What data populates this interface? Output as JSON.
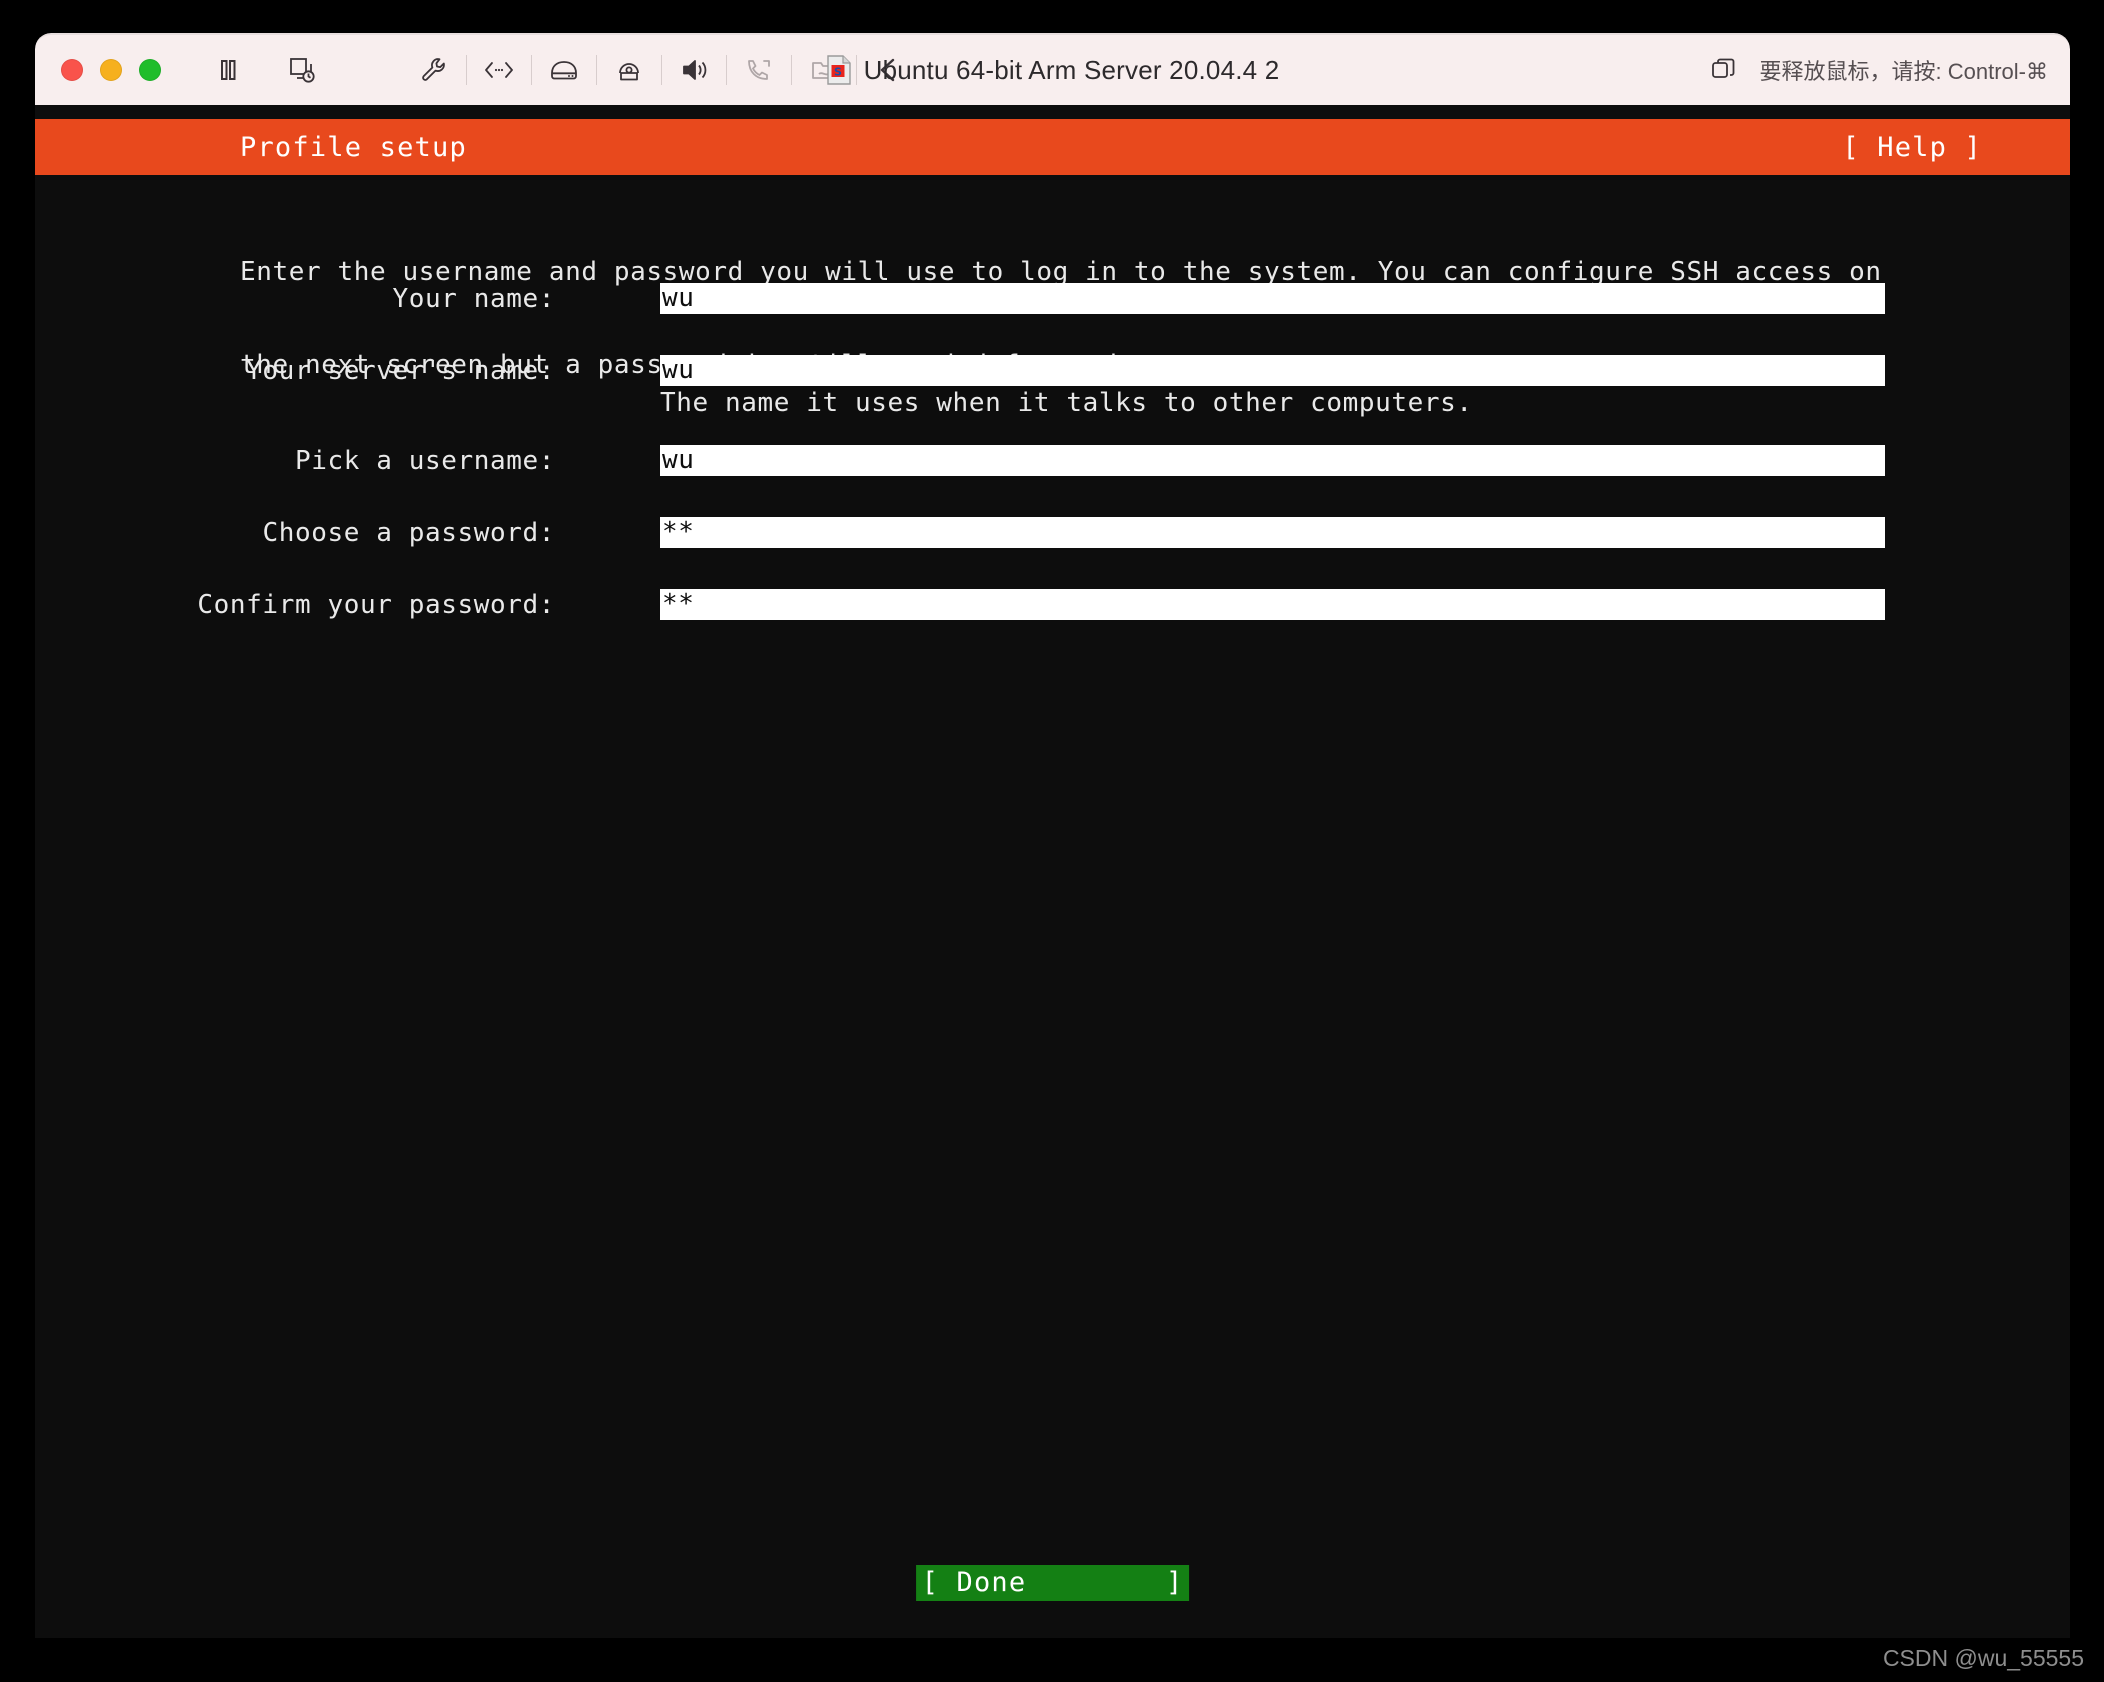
{
  "window": {
    "title": "Ubuntu 64-bit Arm Server 20.04.4 2",
    "release_hint": "要释放鼠标，请按: Control-⌘",
    "traffic_lights": [
      {
        "name": "close",
        "color": "#f9534b"
      },
      {
        "name": "minimize",
        "color": "#f6b01e"
      },
      {
        "name": "zoom",
        "color": "#1fbd2b"
      }
    ],
    "toolbar_icons": [
      "pause-icon",
      "snapshot-icon",
      "settings-wrench-icon",
      "network-icon",
      "hard-disk-icon",
      "camera-icon",
      "sound-icon",
      "usb-phone-icon",
      "shared-folder-icon",
      "back-chevron-icon",
      "window-mode-icon"
    ]
  },
  "installer": {
    "header_title": "Profile setup",
    "help_label": "[ Help ]",
    "accent_color": "#e8491d",
    "intro_lines": [
      "Enter the username and password you will use to log in to the system. You can configure SSH access on",
      "the next screen but a password is still needed for sudo."
    ],
    "fields": [
      {
        "label": "Your name:",
        "value": "wu",
        "hint": ""
      },
      {
        "label": "Your server's name:",
        "value": "wu",
        "hint": "The name it uses when it talks to other computers."
      },
      {
        "label": "Pick a username:",
        "value": "wu",
        "hint": ""
      },
      {
        "label": "Choose a password:",
        "value": "**",
        "hint": ""
      },
      {
        "label": "Confirm your password:",
        "value": "**",
        "hint": ""
      }
    ],
    "done_label": "[ Done        ]",
    "done_color": "#148014"
  },
  "watermark": "CSDN @wu_55555"
}
